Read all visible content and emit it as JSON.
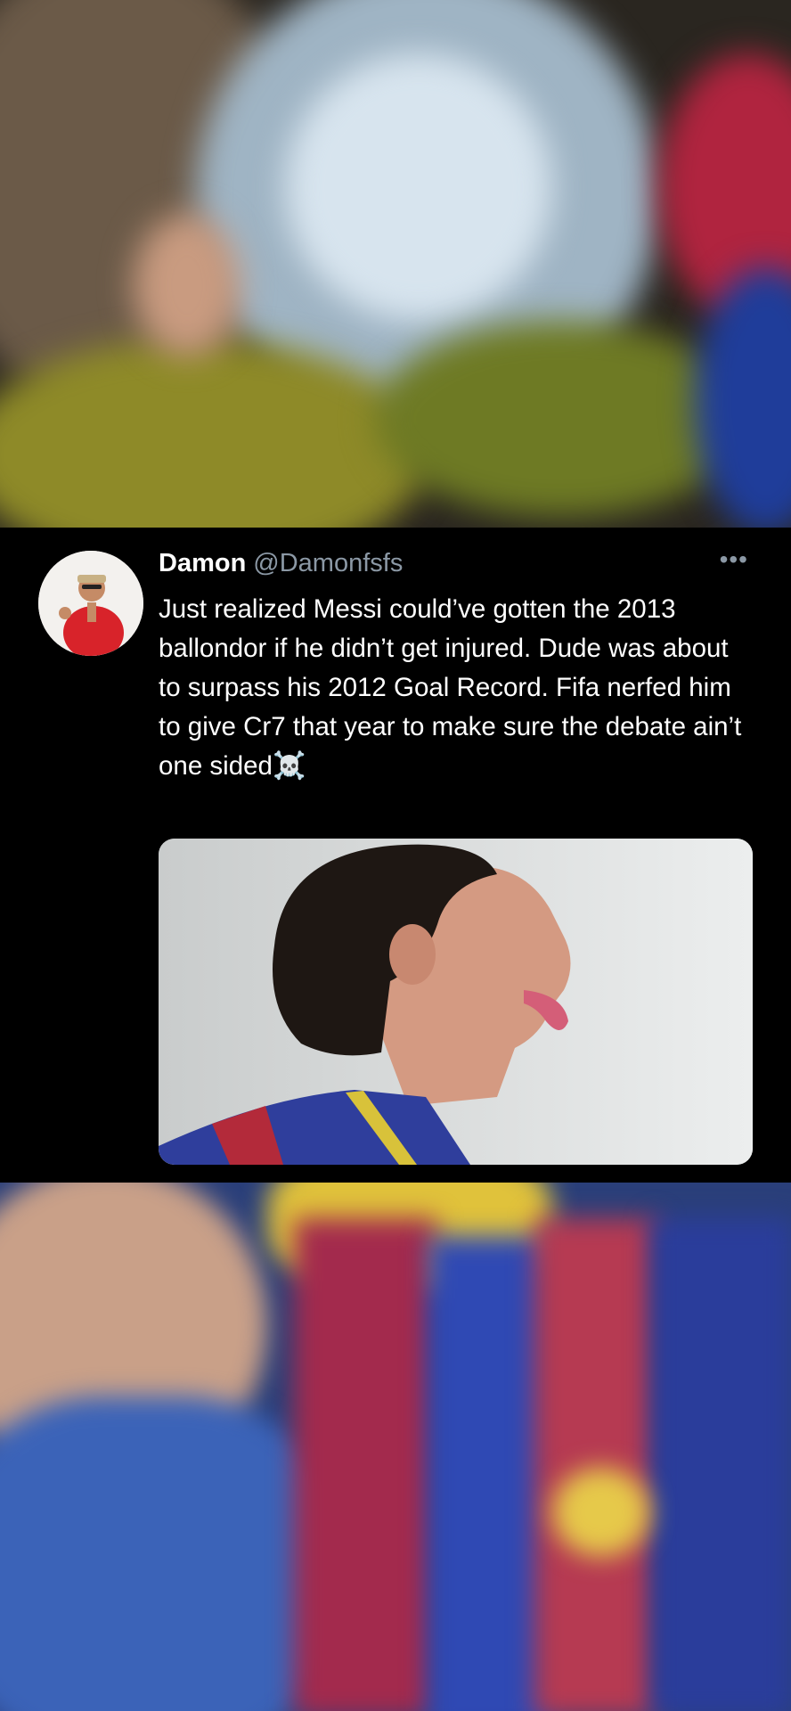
{
  "tweet": {
    "display_name": "Damon",
    "handle": "@Damonfsfs",
    "more_label": "•••",
    "text": "Just realized Messi could’ve gotten the 2013 ballondor if he didn’t get injured. Dude was about to surpass his 2012 Goal Record. Fifa nerfed him to give Cr7 that year to make sure the debate ain’t one sided",
    "emoji": "☠️"
  },
  "icons": {
    "avatar": "profile-photo",
    "more": "more-options-icon",
    "skull": "skull-crossbones-emoji"
  },
  "colors": {
    "background": "#000000",
    "text_primary": "#ffffff",
    "text_secondary": "#8b98a5"
  }
}
